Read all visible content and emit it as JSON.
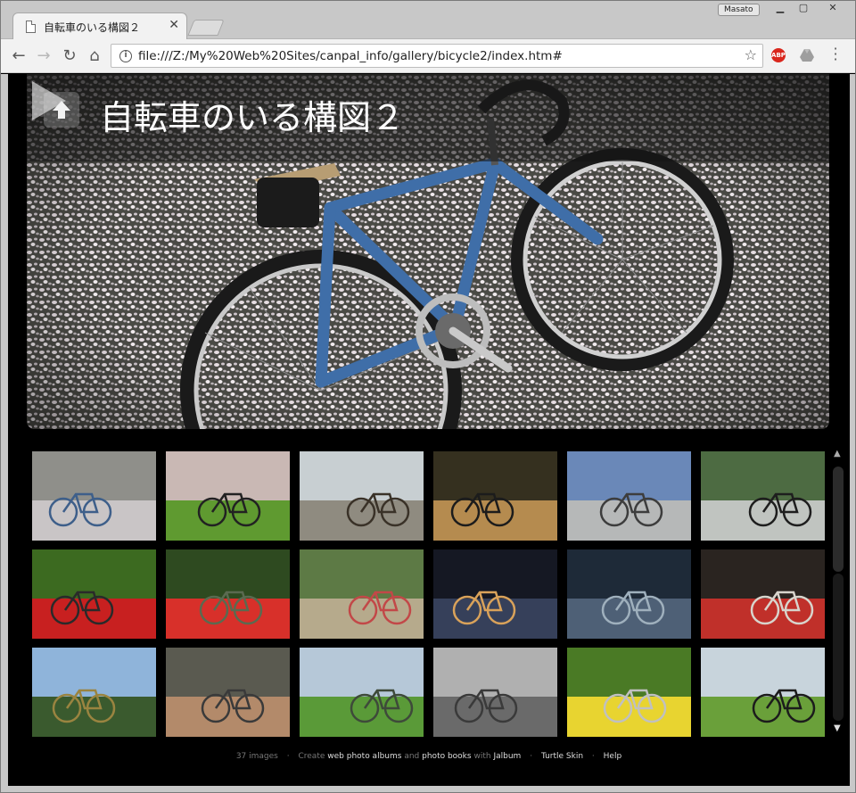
{
  "browser": {
    "tab_title": "自転車のいる構図２",
    "user_name": "Masato",
    "url": "file:///Z:/My%20Web%20Sites/canpal_info/gallery/bicycle2/index.htm#",
    "abp_label": "ABP"
  },
  "gallery": {
    "title": "自転車のいる構図２",
    "image_count": "37 images",
    "thumbnails": [
      {
        "name": "thumb-bike-on-petals",
        "palette": [
          "#8f8f8a",
          "#c9c5c6",
          "#3e5f8a"
        ]
      },
      {
        "name": "thumb-bike-cherry-blossoms",
        "palette": [
          "#c9b8b4",
          "#5f9a30",
          "#222222"
        ]
      },
      {
        "name": "thumb-pier-lake",
        "palette": [
          "#c8cfd2",
          "#8f8b80",
          "#3a3228"
        ]
      },
      {
        "name": "thumb-bike-picnic",
        "palette": [
          "#35301f",
          "#b58b4f",
          "#1c1c1c"
        ]
      },
      {
        "name": "thumb-dome-building",
        "palette": [
          "#6a88b8",
          "#b6b8b8",
          "#3d3d3d"
        ]
      },
      {
        "name": "thumb-folding-bike-forest",
        "palette": [
          "#4d6b42",
          "#c0c4c0",
          "#1e1e1e"
        ]
      },
      {
        "name": "thumb-red-flowers-bike",
        "palette": [
          "#3c6a20",
          "#c82020",
          "#2a2a2a"
        ]
      },
      {
        "name": "thumb-red-lilies",
        "palette": [
          "#2e4a20",
          "#d8302a",
          "#5a6a50"
        ]
      },
      {
        "name": "thumb-village-path",
        "palette": [
          "#5d7a45",
          "#b6aa8c",
          "#c24848"
        ]
      },
      {
        "name": "thumb-dark-shop",
        "palette": [
          "#151823",
          "#36405a",
          "#d9a25a"
        ]
      },
      {
        "name": "thumb-window-table",
        "palette": [
          "#1e2a38",
          "#4e6076",
          "#9fb0bd"
        ]
      },
      {
        "name": "thumb-red-train",
        "palette": [
          "#2a2420",
          "#c0302a",
          "#d8d4cc"
        ]
      },
      {
        "name": "thumb-castle-pond",
        "palette": [
          "#8fb4da",
          "#3a5a2e",
          "#9a8440"
        ]
      },
      {
        "name": "thumb-lakeside-rail",
        "palette": [
          "#5a5a50",
          "#b38a6a",
          "#3a3a3a"
        ]
      },
      {
        "name": "thumb-rice-field",
        "palette": [
          "#b6c8d8",
          "#5a9a38",
          "#3e4a3a"
        ]
      },
      {
        "name": "thumb-foggy-bridge",
        "palette": [
          "#b0b0b0",
          "#6a6a6a",
          "#3a3a3a"
        ]
      },
      {
        "name": "thumb-yellow-flowers",
        "palette": [
          "#4a7a25",
          "#e8d430",
          "#c0c0c0"
        ]
      },
      {
        "name": "thumb-meadow-bike",
        "palette": [
          "#c8d4dc",
          "#6aa03a",
          "#1c1c1c"
        ]
      }
    ]
  },
  "footer": {
    "count": "37 images",
    "create": "Create",
    "albums_link": "web photo albums",
    "and": "and",
    "books_link": "photo books",
    "with": "with",
    "jalbum_link": "Jalbum",
    "skin_link": "Turtle Skin",
    "help_link": "Help",
    "separator": "·"
  },
  "icons": {
    "back": "arrow-left-icon",
    "forward": "arrow-right-icon",
    "reload": "reload-icon",
    "home": "home-icon",
    "info": "info-icon",
    "star": "star-icon",
    "menu": "kebab-menu-icon",
    "up": "up-arrow-icon",
    "next": "next-arrow-icon"
  }
}
